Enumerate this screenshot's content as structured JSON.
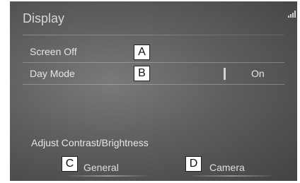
{
  "header": {
    "title": "Display"
  },
  "rows": [
    {
      "label": "Screen Off",
      "callout": "A"
    },
    {
      "label": "Day Mode",
      "callout": "B",
      "value": "On"
    }
  ],
  "contrast": {
    "label": "Adjust Contrast/Brightness",
    "buttons": [
      {
        "label": "General",
        "callout": "C"
      },
      {
        "label": "Camera",
        "callout": "D"
      }
    ]
  }
}
